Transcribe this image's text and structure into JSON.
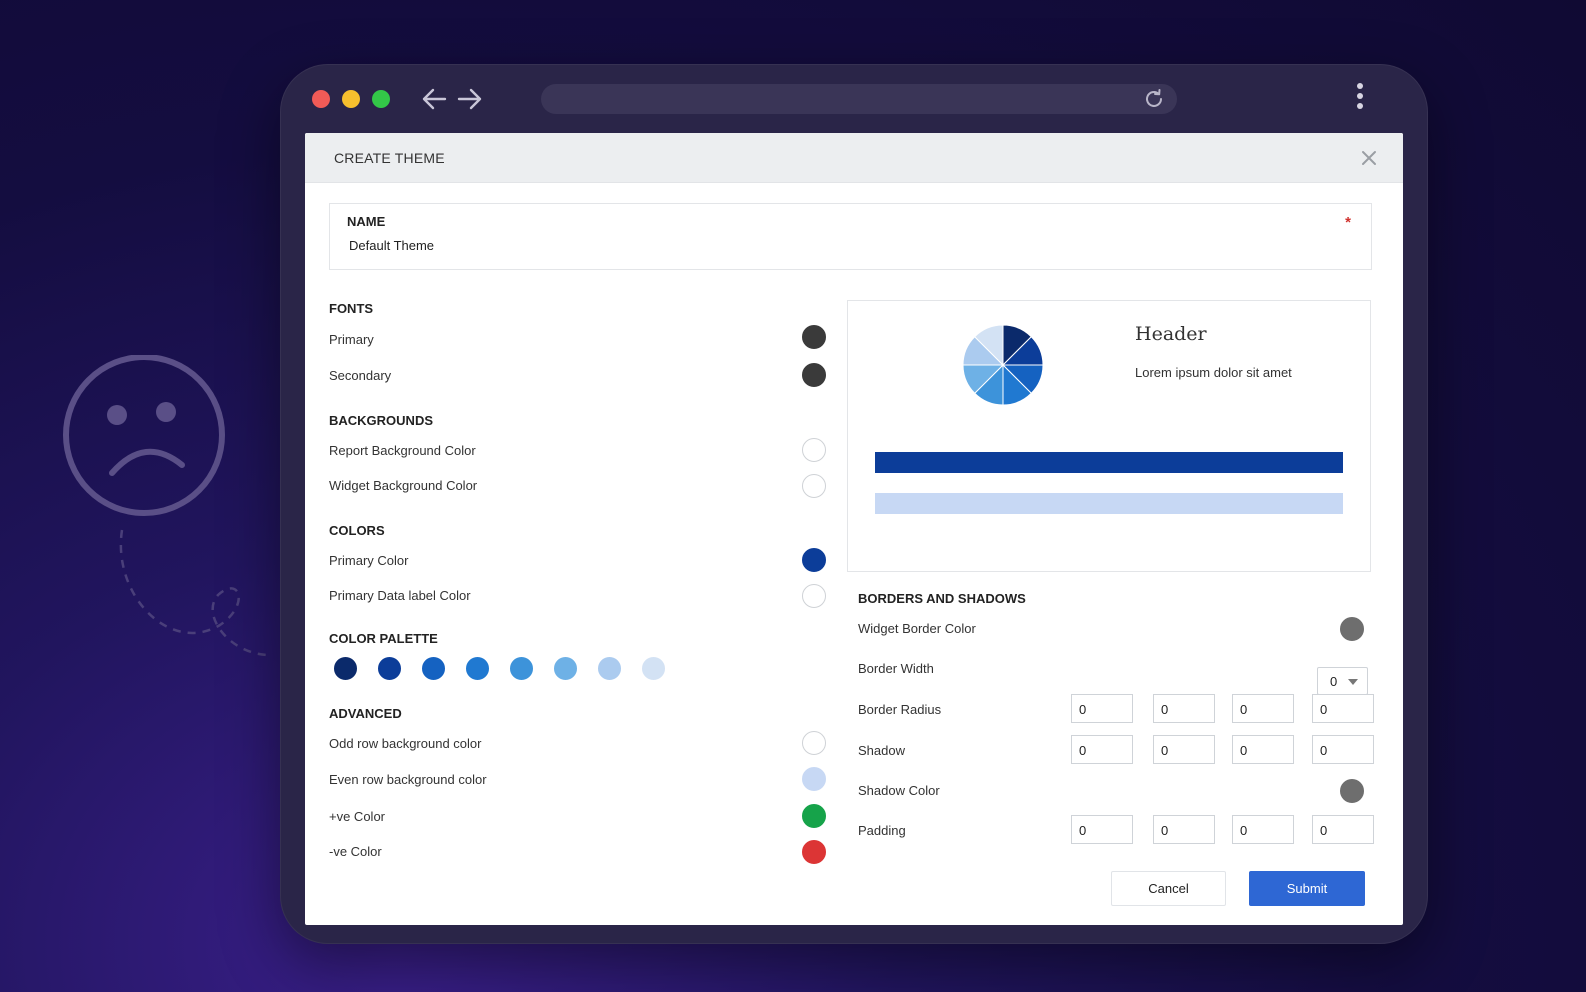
{
  "dialog": {
    "title": "CREATE THEME",
    "name_label": "NAME",
    "name_value": "Default Theme",
    "required_mark": "*"
  },
  "fonts": {
    "title": "FONTS",
    "items": [
      {
        "label": "Primary",
        "color": "#3a3a3a"
      },
      {
        "label": "Secondary",
        "color": "#3a3a3a"
      }
    ]
  },
  "backgrounds": {
    "title": "BACKGROUNDS",
    "items": [
      {
        "label": "Report Background Color",
        "color": "#ffffff"
      },
      {
        "label": "Widget Background Color",
        "color": "#ffffff"
      }
    ]
  },
  "colors": {
    "title": "COLORS",
    "items": [
      {
        "label": "Primary Color",
        "color": "#0c3d99"
      },
      {
        "label": "Primary Data label Color",
        "color": "#ffffff"
      }
    ]
  },
  "palette": {
    "title": "COLOR PALETTE",
    "colors": [
      "#0b2a6b",
      "#0c3d99",
      "#1562c1",
      "#2079d1",
      "#3d93da",
      "#6eb1e6",
      "#abcbef",
      "#d3e2f4"
    ]
  },
  "advanced": {
    "title": "ADVANCED",
    "items": [
      {
        "label": "Odd row background color",
        "color": "#ffffff"
      },
      {
        "label": "Even row background color",
        "color": "#c7d8f4"
      },
      {
        "label": "+ve Color",
        "color": "#16a34a"
      },
      {
        "label": "-ve Color",
        "color": "#dc3535"
      }
    ]
  },
  "preview": {
    "header": "Header",
    "text": "Lorem ipsum dolor sit amet",
    "bar_primary_color": "#0c3d99",
    "bar_secondary_color": "#c7d8f4"
  },
  "borders": {
    "title": "BORDERS AND SHADOWS",
    "widget_border_label": "Widget Border Color",
    "widget_border_color": "#6e6e6e",
    "border_width_label": "Border Width",
    "border_width_value": "0",
    "border_radius_label": "Border Radius",
    "border_radius_values": [
      "0",
      "0",
      "0",
      "0"
    ],
    "shadow_label": "Shadow",
    "shadow_values": [
      "0",
      "0",
      "0",
      "0"
    ],
    "shadow_color_label": "Shadow Color",
    "shadow_color": "#6e6e6e",
    "padding_label": "Padding",
    "padding_values": [
      "0",
      "0",
      "0",
      "0"
    ]
  },
  "actions": {
    "cancel": "Cancel",
    "submit": "Submit"
  }
}
